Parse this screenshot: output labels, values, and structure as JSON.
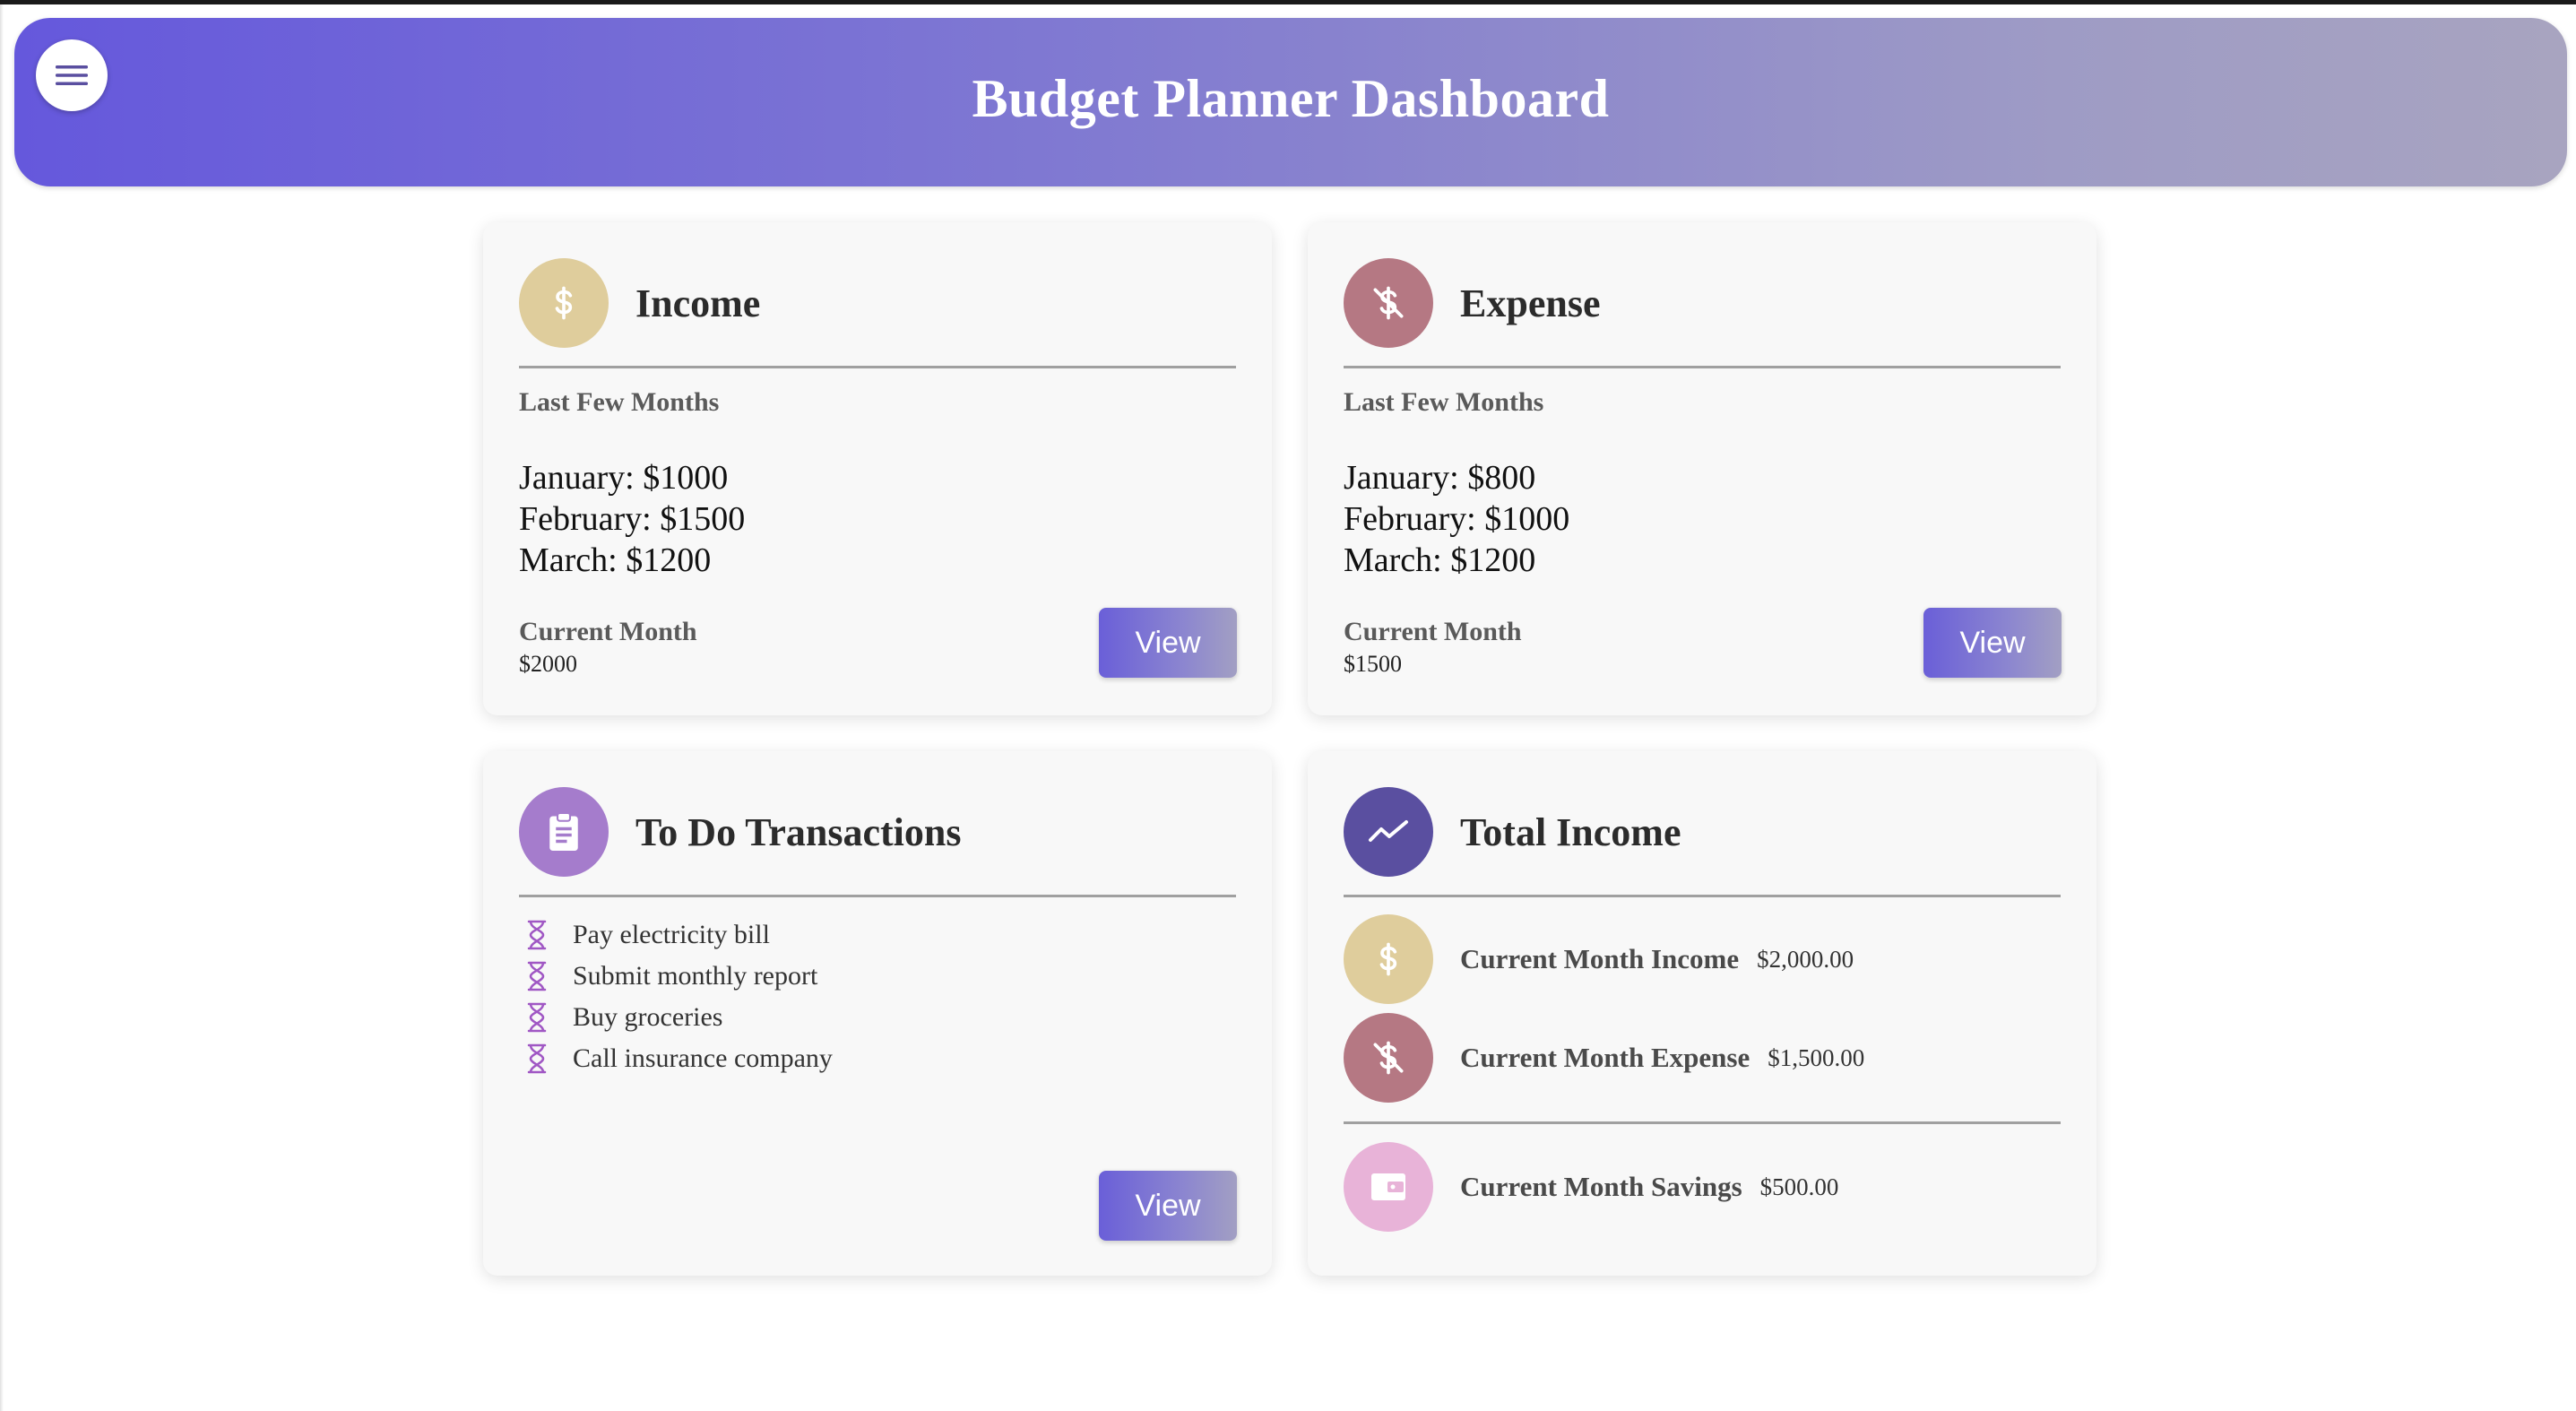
{
  "header": {
    "title": "Budget Planner Dashboard",
    "menu_icon": "hamburger-menu-icon"
  },
  "income_card": {
    "title": "Income",
    "icon": "dollar-icon",
    "icon_color": "#dfcd9c",
    "last_label": "Last Few Months",
    "months": [
      "January: $1000",
      "February: $1500",
      "March: $1200"
    ],
    "current_label": "Current Month",
    "current_value": "$2000",
    "button": "View"
  },
  "expense_card": {
    "title": "Expense",
    "icon": "dollar-off-icon",
    "icon_color": "#b57883",
    "last_label": "Last Few Months",
    "months": [
      "January: $800",
      "February: $1000",
      "March: $1200"
    ],
    "current_label": "Current Month",
    "current_value": "$1500",
    "button": "View"
  },
  "todo_card": {
    "title": "To Do Transactions",
    "icon": "clipboard-icon",
    "icon_color": "#a57ccc",
    "items": [
      "Pay electricity bill",
      "Submit monthly report",
      "Buy groceries",
      "Call insurance company"
    ],
    "item_icon": "hourglass-icon",
    "button": "View"
  },
  "total_card": {
    "title": "Total Income",
    "icon": "trending-up-icon",
    "icon_color": "#5a4fa0",
    "rows": [
      {
        "label": "Current Month Income",
        "value": "$2,000.00",
        "icon": "dollar-icon",
        "color": "#dfcd9c"
      },
      {
        "label": "Current Month Expense",
        "value": "$1,500.00",
        "icon": "dollar-off-icon",
        "color": "#b57883"
      },
      {
        "label": "Current Month Savings",
        "value": "$500.00",
        "icon": "wallet-icon",
        "color": "#e8b3d8"
      }
    ]
  },
  "colors": {
    "header_start": "#6558dc",
    "header_end": "#a8a4c0",
    "button_start": "#6a5fd8",
    "button_end": "#a29fc3"
  }
}
